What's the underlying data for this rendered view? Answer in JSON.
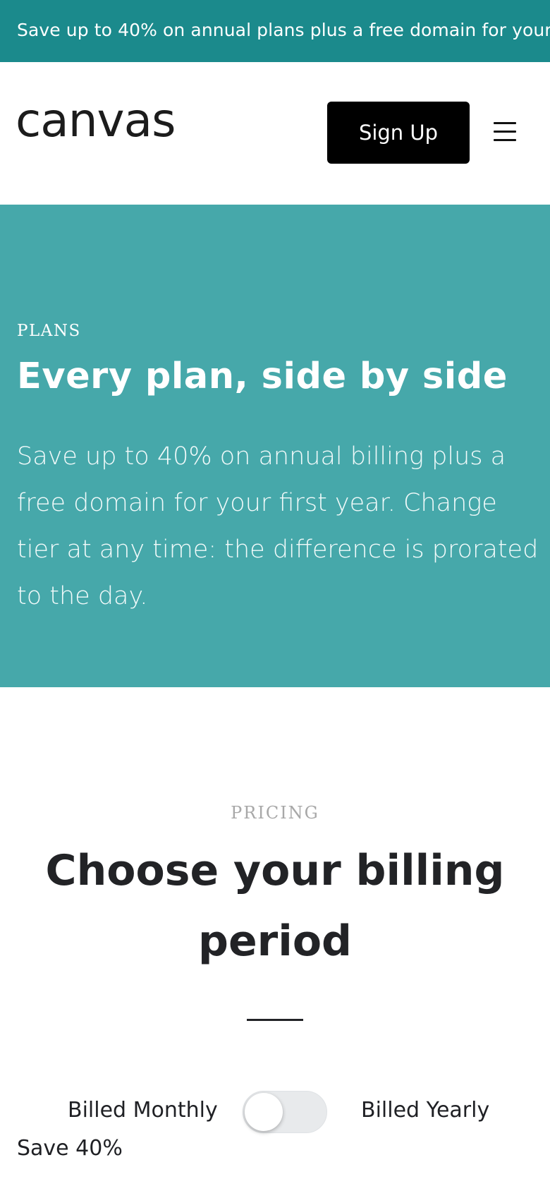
{
  "promo_banner": {
    "text": "Save up to 40% on annual plans plus a free domain for your"
  },
  "header": {
    "logo_text": "canvas",
    "signup_label": "Sign Up",
    "menu_icon": "hamburger-menu-icon"
  },
  "hero": {
    "eyebrow": "PLANS",
    "title": "Every plan, side by side",
    "description": "Save up to 40% on annual billing plus a free domain for your first year. Change tier at any time: the difference is prorated to the day."
  },
  "pricing": {
    "eyebrow": "PRICING",
    "title": "Choose your billing period",
    "billing_monthly_label": "Billed Monthly",
    "billing_yearly_label": "Billed Yearly",
    "toggle_state": "monthly",
    "save_note": "Save 40%"
  },
  "colors": {
    "banner": "#1b8a8c",
    "hero": "#46a8aa",
    "button": "#000000",
    "text_dark": "#1f2024"
  }
}
